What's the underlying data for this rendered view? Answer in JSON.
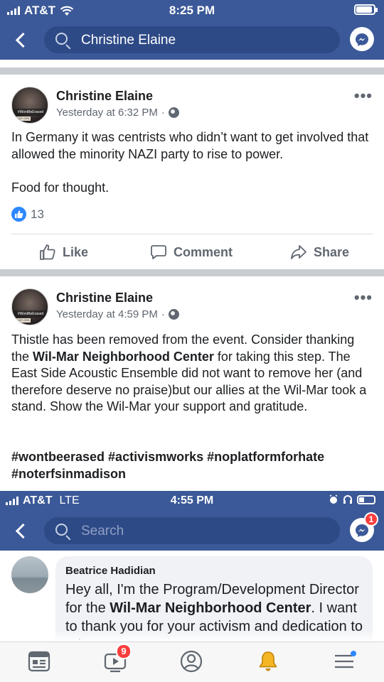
{
  "status_bar": {
    "carrier": "AT&T",
    "time": "8:25 PM"
  },
  "search": {
    "query": "Christine Elaine"
  },
  "posts": [
    {
      "author": "Christine Elaine",
      "timestamp": "Yesterday at 6:32 PM",
      "meta_separator": "·",
      "paragraph1": "In Germany it was centrists who didn’t want to get involved that allowed the minority NAZI party to rise to power.",
      "paragraph2": "Food for thought.",
      "like_count": "13",
      "actions": {
        "like": "Like",
        "comment": "Comment",
        "share": "Share"
      }
    },
    {
      "author": "Christine Elaine",
      "timestamp": "Yesterday at 4:59 PM",
      "meta_separator": "·",
      "body_part1": "Thistle has been removed from the event. Consider thanking the ",
      "body_bold": "Wil-Mar Neighborhood Center",
      "body_part2": " for taking this step. The East Side Acoustic Ensemble did not want to remove her (and therefore deserve no praise)but our allies at the Wil-Mar took a stand.  Show the Wil-Mar your support and gratitude.",
      "hashtags": "#wontbeerased #activismworks #noplatformforhate #noterfsinmadison"
    }
  ],
  "avatar_text": {
    "band": "#WontBeErased",
    "label": "AYER GIRL"
  },
  "embedded": {
    "status_bar": {
      "carrier": "AT&T",
      "network": "LTE",
      "time": "4:55 PM"
    },
    "search_placeholder": "Search",
    "messenger_badge": "1",
    "comment": {
      "author": "Beatrice Hadidian",
      "text_part1": "Hey all, I'm the Program/Development Director for the ",
      "text_bold": "Wil-Mar Neighborhood Center",
      "text_part2": ". I want to thank you for your activism and dedication to raise awareness"
    }
  },
  "tab_bar": {
    "video_badge": "9"
  },
  "colors": {
    "brand": "#3b5998",
    "like_blue": "#2d88ff",
    "badge_red": "#fa3e3e"
  }
}
